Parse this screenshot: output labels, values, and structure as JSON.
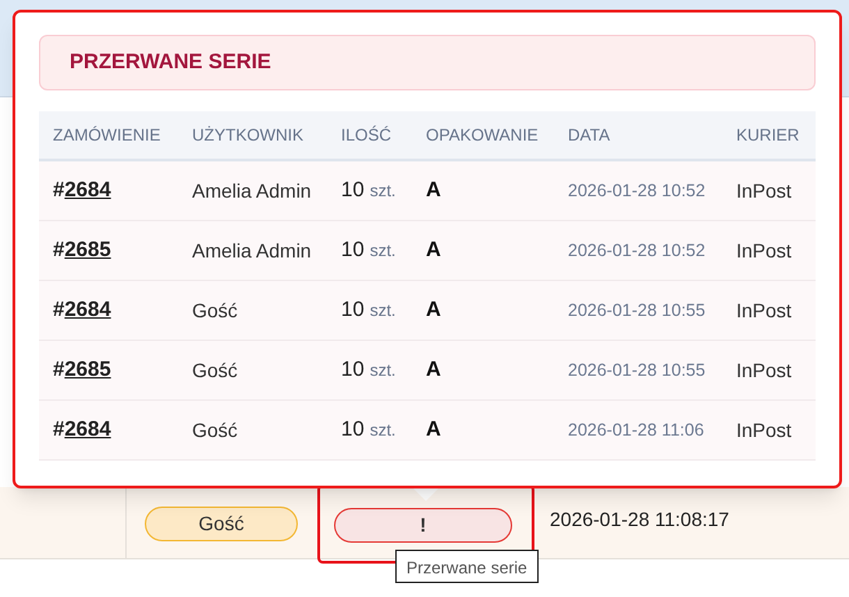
{
  "popover": {
    "title": "PRZERWANE SERIE",
    "columns": [
      "ZAMÓWIENIE",
      "UŻYTKOWNIK",
      "ILOŚĆ",
      "OPAKOWANIE",
      "DATA",
      "KURIER"
    ],
    "rows": [
      {
        "hash": "#",
        "order": "2684",
        "user": "Amelia Admin",
        "qty": "10",
        "unit": "szt.",
        "packaging": "A",
        "date": "2026-01-28 10:52",
        "courier": "InPost"
      },
      {
        "hash": "#",
        "order": "2685",
        "user": "Amelia Admin",
        "qty": "10",
        "unit": "szt.",
        "packaging": "A",
        "date": "2026-01-28 10:52",
        "courier": "InPost"
      },
      {
        "hash": "#",
        "order": "2684",
        "user": "Gość",
        "qty": "10",
        "unit": "szt.",
        "packaging": "A",
        "date": "2026-01-28 10:55",
        "courier": "InPost"
      },
      {
        "hash": "#",
        "order": "2685",
        "user": "Gość",
        "qty": "10",
        "unit": "szt.",
        "packaging": "A",
        "date": "2026-01-28 10:55",
        "courier": "InPost"
      },
      {
        "hash": "#",
        "order": "2684",
        "user": "Gość",
        "qty": "10",
        "unit": "szt.",
        "packaging": "A",
        "date": "2026-01-28 11:06",
        "courier": "InPost"
      }
    ]
  },
  "table_row": {
    "user_badge": "Gość",
    "alert_button": "!",
    "date": "2026-01-28 11:08:17"
  },
  "tooltip": "Przerwane serie"
}
